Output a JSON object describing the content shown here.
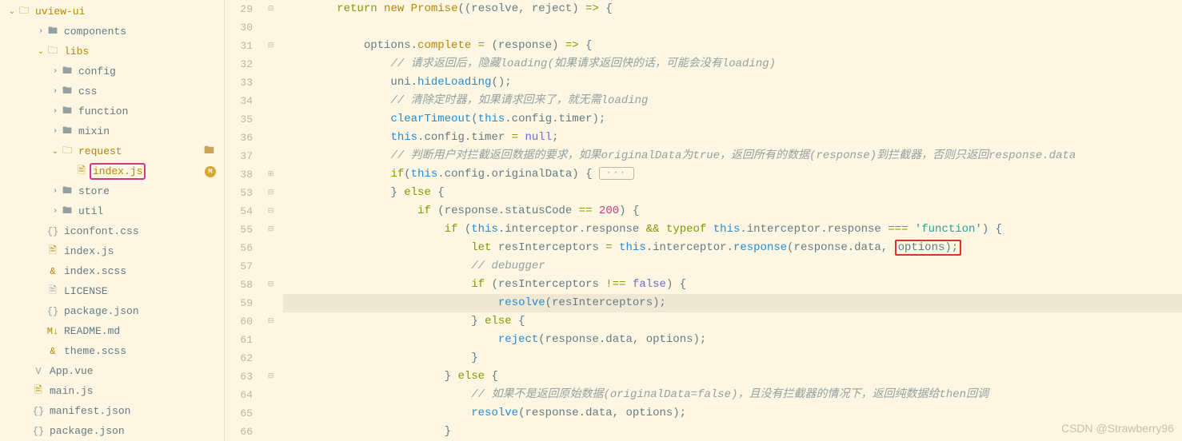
{
  "sidebar": {
    "root": "uview-ui",
    "items": [
      {
        "label": "components",
        "icon": "folder-closed",
        "indent": 1,
        "chev": "›"
      },
      {
        "label": "libs",
        "icon": "folder-open-orange",
        "indent": 1,
        "chev": "⌄",
        "orange": true
      },
      {
        "label": "config",
        "icon": "folder-closed",
        "indent": 2,
        "chev": "›"
      },
      {
        "label": "css",
        "icon": "folder-closed",
        "indent": 2,
        "chev": "›"
      },
      {
        "label": "function",
        "icon": "folder-closed",
        "indent": 2,
        "chev": "›"
      },
      {
        "label": "mixin",
        "icon": "folder-closed",
        "indent": 2,
        "chev": "›"
      },
      {
        "label": "request",
        "icon": "folder-open-orange",
        "indent": 2,
        "chev": "⌄",
        "orange": true,
        "folderMark": true
      },
      {
        "label": "index.js",
        "icon": "file-orange",
        "indent": 3,
        "highlight": true,
        "badge": "M",
        "orange": true
      },
      {
        "label": "store",
        "icon": "folder-closed",
        "indent": 2,
        "chev": "›"
      },
      {
        "label": "util",
        "icon": "folder-closed",
        "indent": 2,
        "chev": "›"
      },
      {
        "label": "iconfont.css",
        "icon": "file-css",
        "indent": 1
      },
      {
        "label": "index.js",
        "icon": "file-js",
        "indent": 1
      },
      {
        "label": "index.scss",
        "icon": "file-scss",
        "indent": 1
      },
      {
        "label": "LICENSE",
        "icon": "file",
        "indent": 1
      },
      {
        "label": "package.json",
        "icon": "file-json",
        "indent": 1
      },
      {
        "label": "README.md",
        "icon": "file-md",
        "indent": 1
      },
      {
        "label": "theme.scss",
        "icon": "file-scss",
        "indent": 1
      },
      {
        "label": "App.vue",
        "icon": "file-vue",
        "indent": 0
      },
      {
        "label": "main.js",
        "icon": "file-js",
        "indent": 0
      },
      {
        "label": "manifest.json",
        "icon": "file-json",
        "indent": 0
      },
      {
        "label": "package.json",
        "icon": "file-json",
        "indent": 0
      }
    ]
  },
  "code": {
    "lines": [
      {
        "num": 29,
        "fold": "⊟",
        "t": [
          {
            "k": "kw-return",
            "v": "return"
          },
          {
            "v": " "
          },
          {
            "k": "kw-new",
            "v": "new"
          },
          {
            "v": " "
          },
          {
            "k": "cls",
            "v": "Promise"
          },
          {
            "v": "((resolve, reject) "
          },
          {
            "k": "op",
            "v": "=>"
          },
          {
            "v": " {"
          }
        ]
      },
      {
        "num": 30,
        "t": []
      },
      {
        "num": 31,
        "fold": "⊟",
        "t": [
          {
            "v": "    options."
          },
          {
            "k": "prop",
            "v": "complete"
          },
          {
            "v": " "
          },
          {
            "k": "op",
            "v": "="
          },
          {
            "v": " (response) "
          },
          {
            "k": "op",
            "v": "=>"
          },
          {
            "v": " {"
          }
        ]
      },
      {
        "num": 32,
        "t": [
          {
            "v": "        "
          },
          {
            "k": "comment",
            "v": "// 请求返回后，隐藏loading(如果请求返回快的话，可能会没有loading)",
            "em": true
          }
        ]
      },
      {
        "num": 33,
        "t": [
          {
            "v": "        uni."
          },
          {
            "k": "method",
            "v": "hideLoading"
          },
          {
            "v": "();"
          }
        ]
      },
      {
        "num": 34,
        "t": [
          {
            "v": "        "
          },
          {
            "k": "comment",
            "v": "// 清除定时器，如果请求回来了，就无需loading",
            "em": true
          }
        ]
      },
      {
        "num": 35,
        "t": [
          {
            "v": "        "
          },
          {
            "k": "func",
            "v": "clearTimeout"
          },
          {
            "v": "("
          },
          {
            "k": "kw-this",
            "v": "this"
          },
          {
            "v": ".config.timer);"
          }
        ]
      },
      {
        "num": 36,
        "t": [
          {
            "v": "        "
          },
          {
            "k": "kw-this",
            "v": "this"
          },
          {
            "v": ".config.timer "
          },
          {
            "k": "op",
            "v": "="
          },
          {
            "v": " "
          },
          {
            "k": "null",
            "v": "null"
          },
          {
            "v": ";"
          }
        ]
      },
      {
        "num": 37,
        "t": [
          {
            "v": "        "
          },
          {
            "k": "comment",
            "v": "// 判断用户对拦截返回数据的要求，如果originalData为true，返回所有的数据(response)到拦截器，否则只返回response.data",
            "em": true
          }
        ]
      },
      {
        "num": 38,
        "fold": "⊞",
        "t": [
          {
            "v": "        "
          },
          {
            "k": "kw-if",
            "v": "if"
          },
          {
            "v": "("
          },
          {
            "k": "kw-this",
            "v": "this"
          },
          {
            "v": ".config.originalData) { "
          },
          {
            "dots": true
          }
        ]
      },
      {
        "num": 53,
        "fold": "⊟",
        "t": [
          {
            "v": "        } "
          },
          {
            "k": "kw-else",
            "v": "else"
          },
          {
            "v": " {"
          }
        ]
      },
      {
        "num": 54,
        "fold": "⊟",
        "t": [
          {
            "v": "            "
          },
          {
            "k": "kw-if",
            "v": "if"
          },
          {
            "v": " (response.statusCode "
          },
          {
            "k": "op",
            "v": "=="
          },
          {
            "v": " "
          },
          {
            "k": "num",
            "v": "200"
          },
          {
            "v": ") {"
          }
        ]
      },
      {
        "num": 55,
        "fold": "⊟",
        "t": [
          {
            "v": "                "
          },
          {
            "k": "kw-if",
            "v": "if"
          },
          {
            "v": " ("
          },
          {
            "k": "kw-this",
            "v": "this"
          },
          {
            "v": ".interceptor.response "
          },
          {
            "k": "op",
            "v": "&&"
          },
          {
            "v": " "
          },
          {
            "k": "kw-typeof",
            "v": "typeof"
          },
          {
            "v": " "
          },
          {
            "k": "kw-this",
            "v": "this"
          },
          {
            "v": ".interceptor.response "
          },
          {
            "k": "op",
            "v": "==="
          },
          {
            "v": " "
          },
          {
            "k": "str",
            "v": "'function'"
          },
          {
            "v": ") {"
          }
        ]
      },
      {
        "num": 56,
        "t": [
          {
            "v": "                    "
          },
          {
            "k": "kw-let",
            "v": "let"
          },
          {
            "v": " resInterceptors "
          },
          {
            "k": "op",
            "v": "="
          },
          {
            "v": " "
          },
          {
            "k": "kw-this",
            "v": "this"
          },
          {
            "v": ".interceptor."
          },
          {
            "k": "method",
            "v": "response"
          },
          {
            "v": "(response.data, "
          },
          {
            "v": "options);",
            "redbox": true
          }
        ]
      },
      {
        "num": 57,
        "t": [
          {
            "v": "                    "
          },
          {
            "k": "comment",
            "v": "// debugger",
            "em": true
          }
        ]
      },
      {
        "num": 58,
        "fold": "⊟",
        "t": [
          {
            "v": "                    "
          },
          {
            "k": "kw-if",
            "v": "if"
          },
          {
            "v": " (resInterceptors "
          },
          {
            "k": "op",
            "v": "!=="
          },
          {
            "v": " "
          },
          {
            "k": "bool",
            "v": "false"
          },
          {
            "v": ") {"
          }
        ]
      },
      {
        "num": 59,
        "current": true,
        "t": [
          {
            "v": "                        "
          },
          {
            "k": "func",
            "v": "resolve"
          },
          {
            "v": "(resInterceptors);"
          }
        ]
      },
      {
        "num": 60,
        "fold": "⊟",
        "t": [
          {
            "v": "                    } "
          },
          {
            "k": "kw-else",
            "v": "else"
          },
          {
            "v": " {"
          }
        ]
      },
      {
        "num": 61,
        "t": [
          {
            "v": "                        "
          },
          {
            "k": "func",
            "v": "reject"
          },
          {
            "v": "(response.data, options);"
          }
        ]
      },
      {
        "num": 62,
        "t": [
          {
            "v": "                    }"
          }
        ]
      },
      {
        "num": 63,
        "fold": "⊟",
        "t": [
          {
            "v": "                } "
          },
          {
            "k": "kw-else",
            "v": "else"
          },
          {
            "v": " {"
          }
        ]
      },
      {
        "num": 64,
        "t": [
          {
            "v": "                    "
          },
          {
            "k": "comment",
            "v": "// 如果不是返回原始数据(originalData=false)，且没有拦截器的情况下，返回纯数据给then回调",
            "em": true
          }
        ]
      },
      {
        "num": 65,
        "t": [
          {
            "v": "                    "
          },
          {
            "k": "func",
            "v": "resolve"
          },
          {
            "v": "(response.data, options);"
          }
        ]
      },
      {
        "num": 66,
        "t": [
          {
            "v": "                }"
          }
        ]
      }
    ]
  },
  "watermark": "CSDN @Strawberry96"
}
